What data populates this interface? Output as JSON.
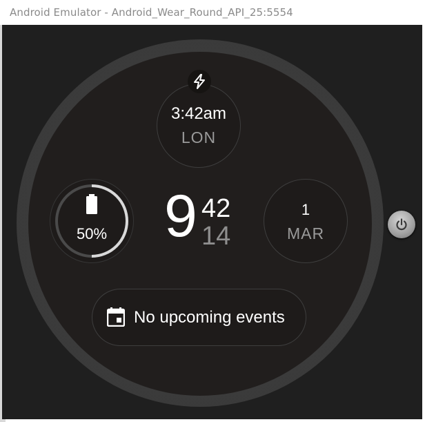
{
  "window": {
    "title": "Android Emulator - Android_Wear_Round_API_25:5554"
  },
  "watchface": {
    "top_complication": {
      "badge_icon": "lightning-bolt-icon",
      "time": "3:42am",
      "city": "LON"
    },
    "left_complication": {
      "icon": "battery-icon",
      "value": "50%",
      "ring_fraction": 0.5
    },
    "center_time": {
      "hour": "9",
      "minutes": "42",
      "seconds": "14"
    },
    "right_complication": {
      "day": "1",
      "month": "MAR"
    },
    "bottom_complication": {
      "icon": "calendar-icon",
      "text": "No upcoming events"
    }
  },
  "controls": {
    "power_icon": "power-icon"
  },
  "colors": {
    "background": "#1f1f1f",
    "face": "#211e1d",
    "bezel": "#3d3d3d",
    "primary_text": "#ffffff",
    "secondary_text": "#9a9a9a"
  }
}
